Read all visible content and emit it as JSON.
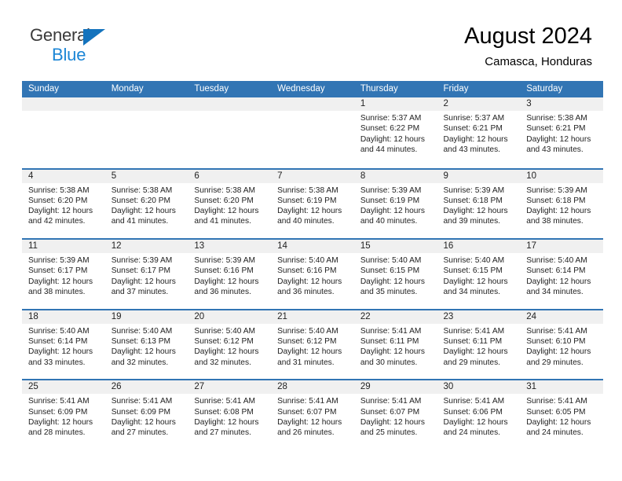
{
  "brand": {
    "line1": "General",
    "line2": "Blue",
    "triangle_color": "#1473bd",
    "line2_color": "#1c86d6"
  },
  "header": {
    "title": "August 2024",
    "subtitle": "Camasca, Honduras"
  },
  "theme": {
    "header_blue": "#3275b4",
    "daynum_band": "#f0f0f0",
    "text": "#222222"
  },
  "calendar": {
    "day_headers": [
      "Sunday",
      "Monday",
      "Tuesday",
      "Wednesday",
      "Thursday",
      "Friday",
      "Saturday"
    ],
    "labels": {
      "sunrise": "Sunrise:",
      "sunset": "Sunset:",
      "daylight": "Daylight:"
    },
    "weeks": [
      [
        {
          "day": "",
          "lines": []
        },
        {
          "day": "",
          "lines": []
        },
        {
          "day": "",
          "lines": []
        },
        {
          "day": "",
          "lines": []
        },
        {
          "day": "1",
          "lines": [
            "Sunrise: 5:37 AM",
            "Sunset: 6:22 PM",
            "Daylight: 12 hours",
            "and 44 minutes."
          ]
        },
        {
          "day": "2",
          "lines": [
            "Sunrise: 5:37 AM",
            "Sunset: 6:21 PM",
            "Daylight: 12 hours",
            "and 43 minutes."
          ]
        },
        {
          "day": "3",
          "lines": [
            "Sunrise: 5:38 AM",
            "Sunset: 6:21 PM",
            "Daylight: 12 hours",
            "and 43 minutes."
          ]
        }
      ],
      [
        {
          "day": "4",
          "lines": [
            "Sunrise: 5:38 AM",
            "Sunset: 6:20 PM",
            "Daylight: 12 hours",
            "and 42 minutes."
          ]
        },
        {
          "day": "5",
          "lines": [
            "Sunrise: 5:38 AM",
            "Sunset: 6:20 PM",
            "Daylight: 12 hours",
            "and 41 minutes."
          ]
        },
        {
          "day": "6",
          "lines": [
            "Sunrise: 5:38 AM",
            "Sunset: 6:20 PM",
            "Daylight: 12 hours",
            "and 41 minutes."
          ]
        },
        {
          "day": "7",
          "lines": [
            "Sunrise: 5:38 AM",
            "Sunset: 6:19 PM",
            "Daylight: 12 hours",
            "and 40 minutes."
          ]
        },
        {
          "day": "8",
          "lines": [
            "Sunrise: 5:39 AM",
            "Sunset: 6:19 PM",
            "Daylight: 12 hours",
            "and 40 minutes."
          ]
        },
        {
          "day": "9",
          "lines": [
            "Sunrise: 5:39 AM",
            "Sunset: 6:18 PM",
            "Daylight: 12 hours",
            "and 39 minutes."
          ]
        },
        {
          "day": "10",
          "lines": [
            "Sunrise: 5:39 AM",
            "Sunset: 6:18 PM",
            "Daylight: 12 hours",
            "and 38 minutes."
          ]
        }
      ],
      [
        {
          "day": "11",
          "lines": [
            "Sunrise: 5:39 AM",
            "Sunset: 6:17 PM",
            "Daylight: 12 hours",
            "and 38 minutes."
          ]
        },
        {
          "day": "12",
          "lines": [
            "Sunrise: 5:39 AM",
            "Sunset: 6:17 PM",
            "Daylight: 12 hours",
            "and 37 minutes."
          ]
        },
        {
          "day": "13",
          "lines": [
            "Sunrise: 5:39 AM",
            "Sunset: 6:16 PM",
            "Daylight: 12 hours",
            "and 36 minutes."
          ]
        },
        {
          "day": "14",
          "lines": [
            "Sunrise: 5:40 AM",
            "Sunset: 6:16 PM",
            "Daylight: 12 hours",
            "and 36 minutes."
          ]
        },
        {
          "day": "15",
          "lines": [
            "Sunrise: 5:40 AM",
            "Sunset: 6:15 PM",
            "Daylight: 12 hours",
            "and 35 minutes."
          ]
        },
        {
          "day": "16",
          "lines": [
            "Sunrise: 5:40 AM",
            "Sunset: 6:15 PM",
            "Daylight: 12 hours",
            "and 34 minutes."
          ]
        },
        {
          "day": "17",
          "lines": [
            "Sunrise: 5:40 AM",
            "Sunset: 6:14 PM",
            "Daylight: 12 hours",
            "and 34 minutes."
          ]
        }
      ],
      [
        {
          "day": "18",
          "lines": [
            "Sunrise: 5:40 AM",
            "Sunset: 6:14 PM",
            "Daylight: 12 hours",
            "and 33 minutes."
          ]
        },
        {
          "day": "19",
          "lines": [
            "Sunrise: 5:40 AM",
            "Sunset: 6:13 PM",
            "Daylight: 12 hours",
            "and 32 minutes."
          ]
        },
        {
          "day": "20",
          "lines": [
            "Sunrise: 5:40 AM",
            "Sunset: 6:12 PM",
            "Daylight: 12 hours",
            "and 32 minutes."
          ]
        },
        {
          "day": "21",
          "lines": [
            "Sunrise: 5:40 AM",
            "Sunset: 6:12 PM",
            "Daylight: 12 hours",
            "and 31 minutes."
          ]
        },
        {
          "day": "22",
          "lines": [
            "Sunrise: 5:41 AM",
            "Sunset: 6:11 PM",
            "Daylight: 12 hours",
            "and 30 minutes."
          ]
        },
        {
          "day": "23",
          "lines": [
            "Sunrise: 5:41 AM",
            "Sunset: 6:11 PM",
            "Daylight: 12 hours",
            "and 29 minutes."
          ]
        },
        {
          "day": "24",
          "lines": [
            "Sunrise: 5:41 AM",
            "Sunset: 6:10 PM",
            "Daylight: 12 hours",
            "and 29 minutes."
          ]
        }
      ],
      [
        {
          "day": "25",
          "lines": [
            "Sunrise: 5:41 AM",
            "Sunset: 6:09 PM",
            "Daylight: 12 hours",
            "and 28 minutes."
          ]
        },
        {
          "day": "26",
          "lines": [
            "Sunrise: 5:41 AM",
            "Sunset: 6:09 PM",
            "Daylight: 12 hours",
            "and 27 minutes."
          ]
        },
        {
          "day": "27",
          "lines": [
            "Sunrise: 5:41 AM",
            "Sunset: 6:08 PM",
            "Daylight: 12 hours",
            "and 27 minutes."
          ]
        },
        {
          "day": "28",
          "lines": [
            "Sunrise: 5:41 AM",
            "Sunset: 6:07 PM",
            "Daylight: 12 hours",
            "and 26 minutes."
          ]
        },
        {
          "day": "29",
          "lines": [
            "Sunrise: 5:41 AM",
            "Sunset: 6:07 PM",
            "Daylight: 12 hours",
            "and 25 minutes."
          ]
        },
        {
          "day": "30",
          "lines": [
            "Sunrise: 5:41 AM",
            "Sunset: 6:06 PM",
            "Daylight: 12 hours",
            "and 24 minutes."
          ]
        },
        {
          "day": "31",
          "lines": [
            "Sunrise: 5:41 AM",
            "Sunset: 6:05 PM",
            "Daylight: 12 hours",
            "and 24 minutes."
          ]
        }
      ]
    ]
  }
}
